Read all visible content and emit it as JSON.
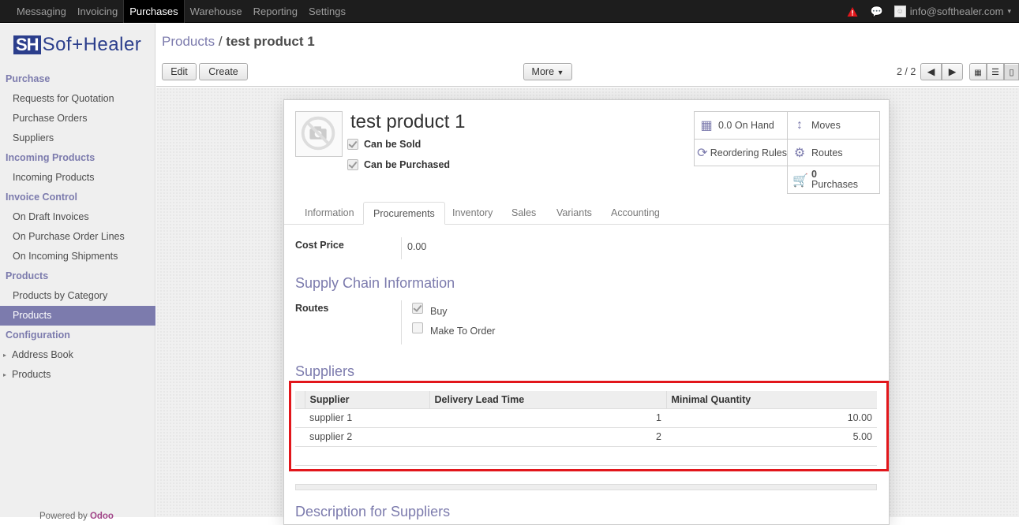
{
  "topbar": {
    "menus": [
      "Messaging",
      "Invoicing",
      "Purchases",
      "Warehouse",
      "Reporting",
      "Settings"
    ],
    "active_menu": "Purchases",
    "user": "info@softhealer.com"
  },
  "logo": {
    "mark": "SH",
    "text": "Soft Healer",
    "mark_text": "SH",
    "word": "Sof+Healer"
  },
  "sidebar": {
    "sections": [
      {
        "title": "Purchase",
        "items": [
          "Requests for Quotation",
          "Purchase Orders",
          "Suppliers"
        ]
      },
      {
        "title": "Incoming Products",
        "items": [
          "Incoming Products"
        ]
      },
      {
        "title": "Invoice Control",
        "items": [
          "On Draft Invoices",
          "On Purchase Order Lines",
          "On Incoming Shipments"
        ]
      },
      {
        "title": "Products",
        "items": [
          "Products by Category",
          "Products"
        ]
      },
      {
        "title": "Configuration",
        "items": [
          "Address Book",
          "Products"
        ]
      }
    ],
    "powered_prefix": "Powered by",
    "powered_brand": "Odoo"
  },
  "breadcrumb": {
    "parent": "Products",
    "separator": "/",
    "current": "test product 1"
  },
  "toolbar": {
    "edit": "Edit",
    "create": "Create",
    "more": "More",
    "pager": "2 / 2"
  },
  "product": {
    "name": "test product 1",
    "can_be_sold": "Can be Sold",
    "can_be_purchased": "Can be Purchased"
  },
  "smart_buttons": {
    "on_hand": "0.0 On Hand",
    "moves": "Moves",
    "reordering": "Reordering Rules",
    "routes": "Routes",
    "purchases_count": "0",
    "purchases_label": "Purchases"
  },
  "tabs": [
    "Information",
    "Procurements",
    "Inventory",
    "Sales",
    "Variants",
    "Accounting"
  ],
  "active_tab": "Procurements",
  "procurements": {
    "cost_price_label": "Cost Price",
    "cost_price_value": "0.00",
    "supply_chain_title": "Supply Chain Information",
    "routes_label": "Routes",
    "route_buy": "Buy",
    "route_mto": "Make To Order",
    "suppliers_title": "Suppliers",
    "suppliers_columns": [
      "Supplier",
      "Delivery Lead Time",
      "Minimal Quantity"
    ],
    "suppliers_rows": [
      {
        "supplier": "supplier 1",
        "lead_time": "1",
        "min_qty": "10.00"
      },
      {
        "supplier": "supplier 2",
        "lead_time": "2",
        "min_qty": "5.00"
      }
    ],
    "description_title": "Description for Suppliers"
  },
  "colors": {
    "accent": "#7c7bad",
    "highlight": "#e2161b",
    "topbar": "#1d1d1d"
  }
}
